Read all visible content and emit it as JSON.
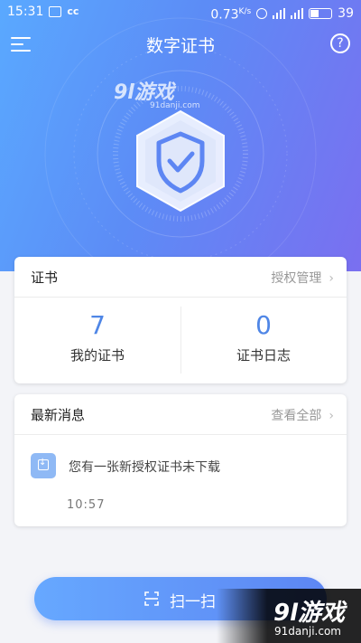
{
  "status_bar": {
    "time": "15:31",
    "left_icons": [
      "mail-icon",
      "cc-icon"
    ],
    "speed": "0.73",
    "speed_unit": "K/s",
    "right_icons": [
      "alarm-icon",
      "signal-4g-icon",
      "signal-icon",
      "toggle-icon"
    ],
    "battery": "39"
  },
  "header": {
    "title": "数字证书",
    "help_label": "?"
  },
  "hero": {
    "watermark_main": "9l游戏",
    "watermark_sub": "91danji.com"
  },
  "certificates": {
    "title": "证书",
    "manage_link": "授权管理",
    "chevron": "›",
    "stats": [
      {
        "value": "7",
        "label": "我的证书"
      },
      {
        "value": "0",
        "label": "证书日志"
      }
    ]
  },
  "news": {
    "title": "最新消息",
    "view_all": "查看全部",
    "chevron": "›",
    "message": {
      "text": "您有一张新授权证书未下载",
      "time": "10:57"
    }
  },
  "scan": {
    "label": "扫一扫"
  },
  "corner_watermark": {
    "main": "9l游戏",
    "sub": "91danji.com"
  },
  "colors": {
    "accent": "#4f86e6",
    "hero_start": "#5aa9ff",
    "hero_end": "#7a6ff0"
  }
}
